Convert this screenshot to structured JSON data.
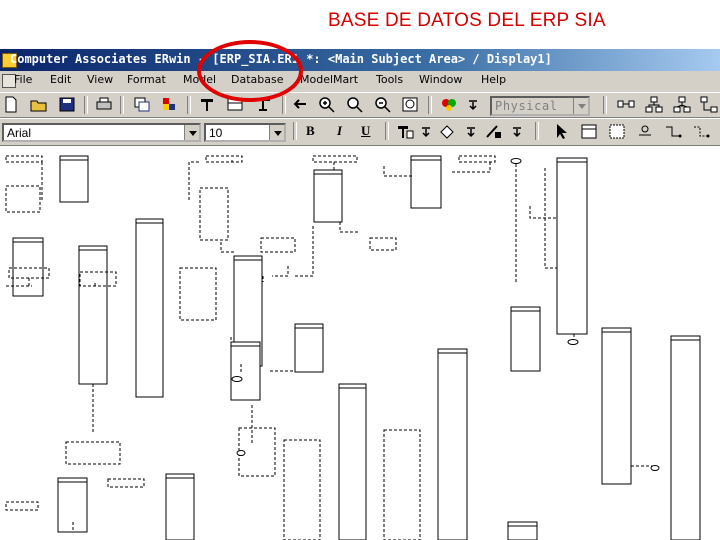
{
  "slide": {
    "title": "BASE DE DATOS DEL ERP SIA"
  },
  "window": {
    "title": "Computer Associates ERwin - [ERP_SIA.ER1 *: <Main Subject Area> / Display1]"
  },
  "menu": {
    "items": [
      "File",
      "Edit",
      "View",
      "Format",
      "Model",
      "Database",
      "ModelMart",
      "Tools",
      "Window",
      "Help"
    ]
  },
  "toolbar": {
    "model_view": "Physical",
    "font_name": "Arial",
    "font_size": "10",
    "bold": "B",
    "italic": "I",
    "underline": "U"
  },
  "colors": {
    "annotation": "#e00000",
    "title_text": "#d40000",
    "titlebar_start": "#0a246a"
  }
}
